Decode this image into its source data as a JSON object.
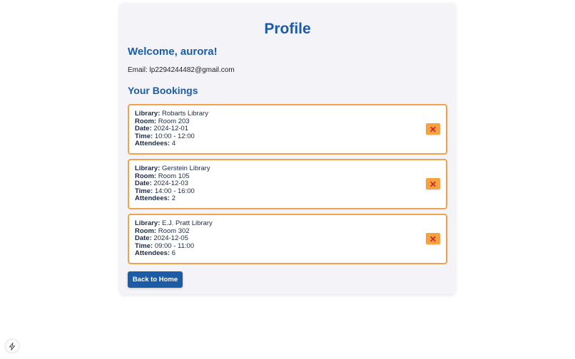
{
  "page": {
    "title": "Profile",
    "welcome": "Welcome, aurora!",
    "email": "Email: lp2294244482@gmail.com",
    "bookings_heading": "Your Bookings",
    "back_button": "Back to Home"
  },
  "labels": {
    "library": "Library:",
    "room": "Room:",
    "date": "Date:",
    "time": "Time:",
    "attendees": "Attendees:"
  },
  "bookings": [
    {
      "library": "Robarts Library",
      "room": "Room 203",
      "date": "2024-12-01",
      "time": "10:00 - 12:00",
      "attendees": "4"
    },
    {
      "library": "Gerstein Library",
      "room": "Room 105",
      "date": "2024-12-03",
      "time": "14:00 - 16:00",
      "attendees": "2"
    },
    {
      "library": "E.J. Pratt Library",
      "room": "Room 302",
      "date": "2024-12-05",
      "time": "09:00 - 11:00",
      "attendees": "6"
    }
  ],
  "icons": {
    "delete": "close-icon",
    "corner": "lightning-icon"
  },
  "colors": {
    "heading": "#1c5ca6",
    "booking_border": "#f1a24a",
    "delete_button": "#f4a340",
    "delete_x": "#d0262b",
    "back_button": "#1c5ca6"
  }
}
